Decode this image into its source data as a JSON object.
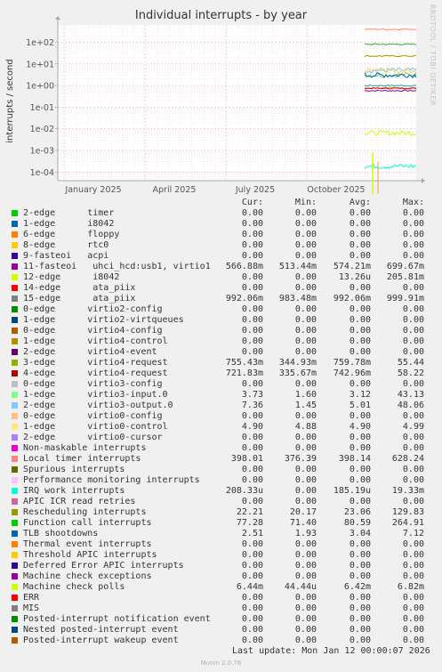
{
  "title": "Individual interrupts - by year",
  "side_label": "RRDTOOL / TOBI OETIKER",
  "chart_data": {
    "type": "line",
    "title": "Individual interrupts - by year",
    "ylabel": "interrupts / second",
    "yscale": "log",
    "y_ticks": [
      "1e+02",
      "1e+01",
      "1e+00",
      "1e-01",
      "1e-02",
      "1e-03",
      "1e-04"
    ],
    "x_ticks": [
      "January 2025",
      "April 2025",
      "July 2025",
      "October 2025"
    ],
    "grid": true,
    "series": [
      {
        "name": "11-fasteoi uhci_hcd:usb1, virtio1",
        "color": "#990099",
        "level": 0.574
      },
      {
        "name": "15-edge ata_piix",
        "color": "#339999",
        "level": 0.992
      },
      {
        "name": "3-edge virtio4-request",
        "color": "#99cc00",
        "level": 0.76
      },
      {
        "name": "4-edge virtio4-request",
        "color": "#cc0033",
        "level": 0.743
      },
      {
        "name": "1-edge virtio3-input.0",
        "color": "#66cc66",
        "level": 3.12
      },
      {
        "name": "2-edge virtio3-output.0",
        "color": "#66ccff",
        "level": 5.01
      },
      {
        "name": "1-edge virtio0-control",
        "color": "#ffcc66",
        "level": 4.9
      },
      {
        "name": "Local timer interrupts",
        "color": "#ff8866",
        "level": 398.14
      },
      {
        "name": "Rescheduling interrupts",
        "color": "#999900",
        "level": 23.06
      },
      {
        "name": "Function call interrupts",
        "color": "#33aa33",
        "level": 80.59
      },
      {
        "name": "TLB shootdowns",
        "color": "#0066b3",
        "level": 3.04
      },
      {
        "name": "Machine check polls",
        "color": "#ccff00",
        "level": 0.00642
      },
      {
        "name": "IRQ work interrupts",
        "color": "#00ffcc",
        "level": 0.000185
      }
    ]
  },
  "table": {
    "headers": {
      "cur": "Cur:",
      "min": "Min:",
      "avg": "Avg:",
      "max": "Max:"
    },
    "rows": [
      {
        "label": "2-edge      timer",
        "color": "#00cc00",
        "cur": "0.00",
        "min": "0.00",
        "avg": "0.00",
        "max": "0.00"
      },
      {
        "label": "1-edge      i8042",
        "color": "#0066b3",
        "cur": "0.00",
        "min": "0.00",
        "avg": "0.00",
        "max": "0.00"
      },
      {
        "label": "6-edge      floppy",
        "color": "#ff8000",
        "cur": "0.00",
        "min": "0.00",
        "avg": "0.00",
        "max": "0.00"
      },
      {
        "label": "8-edge      rtc0",
        "color": "#ffcc00",
        "cur": "0.00",
        "min": "0.00",
        "avg": "0.00",
        "max": "0.00"
      },
      {
        "label": "9-fasteoi   acpi",
        "color": "#330099",
        "cur": "0.00",
        "min": "0.00",
        "avg": "0.00",
        "max": "0.00"
      },
      {
        "label": "11-fasteoi   uhci_hcd:usb1, virtio1",
        "color": "#990099",
        "cur": "566.88m",
        "min": "513.44m",
        "avg": "574.21m",
        "max": "699.67m"
      },
      {
        "label": "12-edge      i8042",
        "color": "#ccff00",
        "cur": "0.00",
        "min": "0.00",
        "avg": "13.26u",
        "max": "205.81m"
      },
      {
        "label": "14-edge      ata_piix",
        "color": "#ff0000",
        "cur": "0.00",
        "min": "0.00",
        "avg": "0.00",
        "max": "0.00"
      },
      {
        "label": "15-edge      ata_piix",
        "color": "#808080",
        "cur": "992.06m",
        "min": "983.48m",
        "avg": "992.06m",
        "max": "999.91m"
      },
      {
        "label": "0-edge      virtio2-config",
        "color": "#008f00",
        "cur": "0.00",
        "min": "0.00",
        "avg": "0.00",
        "max": "0.00"
      },
      {
        "label": "1-edge      virtio2-virtqueues",
        "color": "#00487d",
        "cur": "0.00",
        "min": "0.00",
        "avg": "0.00",
        "max": "0.00"
      },
      {
        "label": "0-edge      virtio4-config",
        "color": "#b35a00",
        "cur": "0.00",
        "min": "0.00",
        "avg": "0.00",
        "max": "0.00"
      },
      {
        "label": "1-edge      virtio4-control",
        "color": "#b38f00",
        "cur": "0.00",
        "min": "0.00",
        "avg": "0.00",
        "max": "0.00"
      },
      {
        "label": "2-edge      virtio4-event",
        "color": "#6b006b",
        "cur": "0.00",
        "min": "0.00",
        "avg": "0.00",
        "max": "0.00"
      },
      {
        "label": "3-edge      virtio4-request",
        "color": "#8fb300",
        "cur": "755.43m",
        "min": "344.93m",
        "avg": "759.78m",
        "max": "55.44"
      },
      {
        "label": "4-edge      virtio4-request",
        "color": "#b30000",
        "cur": "721.83m",
        "min": "335.67m",
        "avg": "742.96m",
        "max": "58.22"
      },
      {
        "label": "0-edge      virtio3-config",
        "color": "#bebebe",
        "cur": "0.00",
        "min": "0.00",
        "avg": "0.00",
        "max": "0.00"
      },
      {
        "label": "1-edge      virtio3-input.0",
        "color": "#80ff80",
        "cur": "3.73",
        "min": "1.60",
        "avg": "3.12",
        "max": "43.13"
      },
      {
        "label": "2-edge      virtio3-output.0",
        "color": "#80c9ff",
        "cur": "7.36",
        "min": "1.45",
        "avg": "5.01",
        "max": "48.06"
      },
      {
        "label": "0-edge      virtio0-config",
        "color": "#ffc080",
        "cur": "0.00",
        "min": "0.00",
        "avg": "0.00",
        "max": "0.00"
      },
      {
        "label": "1-edge      virtio0-control",
        "color": "#ffe680",
        "cur": "4.90",
        "min": "4.88",
        "avg": "4.90",
        "max": "4.99"
      },
      {
        "label": "2-edge      virtio0-cursor",
        "color": "#aa80ff",
        "cur": "0.00",
        "min": "0.00",
        "avg": "0.00",
        "max": "0.00"
      },
      {
        "label": "Non-maskable interrupts",
        "color": "#ee00cc",
        "cur": "0.00",
        "min": "0.00",
        "avg": "0.00",
        "max": "0.00"
      },
      {
        "label": "Local timer interrupts",
        "color": "#ff8080",
        "cur": "398.01",
        "min": "376.39",
        "avg": "398.14",
        "max": "628.24"
      },
      {
        "label": "Spurious interrupts",
        "color": "#666600",
        "cur": "0.00",
        "min": "0.00",
        "avg": "0.00",
        "max": "0.00"
      },
      {
        "label": "Performance monitoring interrupts",
        "color": "#ffbfff",
        "cur": "0.00",
        "min": "0.00",
        "avg": "0.00",
        "max": "0.00"
      },
      {
        "label": "IRQ work interrupts",
        "color": "#00ffcc",
        "cur": "208.33u",
        "min": "0.00",
        "avg": "185.19u",
        "max": "19.33m"
      },
      {
        "label": "APIC ICR read retries",
        "color": "#cc6699",
        "cur": "0.00",
        "min": "0.00",
        "avg": "0.00",
        "max": "0.00"
      },
      {
        "label": "Rescheduling interrupts",
        "color": "#999900",
        "cur": "22.21",
        "min": "20.17",
        "avg": "23.06",
        "max": "129.83"
      },
      {
        "label": "Function call interrupts",
        "color": "#00cc00",
        "cur": "77.28",
        "min": "71.40",
        "avg": "80.59",
        "max": "264.91"
      },
      {
        "label": "TLB shootdowns",
        "color": "#0066b3",
        "cur": "2.51",
        "min": "1.93",
        "avg": "3.04",
        "max": "7.12"
      },
      {
        "label": "Thermal event interrupts",
        "color": "#ff8000",
        "cur": "0.00",
        "min": "0.00",
        "avg": "0.00",
        "max": "0.00"
      },
      {
        "label": "Threshold APIC interrupts",
        "color": "#ffcc00",
        "cur": "0.00",
        "min": "0.00",
        "avg": "0.00",
        "max": "0.00"
      },
      {
        "label": "Deferred Error APIC interrupts",
        "color": "#330099",
        "cur": "0.00",
        "min": "0.00",
        "avg": "0.00",
        "max": "0.00"
      },
      {
        "label": "Machine check exceptions",
        "color": "#990099",
        "cur": "0.00",
        "min": "0.00",
        "avg": "0.00",
        "max": "0.00"
      },
      {
        "label": "Machine check polls",
        "color": "#ccff00",
        "cur": "6.44m",
        "min": "44.44u",
        "avg": "6.42m",
        "max": "6.82m"
      },
      {
        "label": "ERR",
        "color": "#ff0000",
        "cur": "0.00",
        "min": "0.00",
        "avg": "0.00",
        "max": "0.00"
      },
      {
        "label": "MIS",
        "color": "#808080",
        "cur": "0.00",
        "min": "0.00",
        "avg": "0.00",
        "max": "0.00"
      },
      {
        "label": "Posted-interrupt notification event",
        "color": "#008f00",
        "cur": "0.00",
        "min": "0.00",
        "avg": "0.00",
        "max": "0.00"
      },
      {
        "label": "Nested posted-interrupt event",
        "color": "#00487d",
        "cur": "0.00",
        "min": "0.00",
        "avg": "0.00",
        "max": "0.00"
      },
      {
        "label": "Posted-interrupt wakeup event",
        "color": "#b35a00",
        "cur": "0.00",
        "min": "0.00",
        "avg": "0.00",
        "max": "0.00"
      }
    ]
  },
  "footer": "Last update: Mon Jan 12 00:00:07 2026",
  "munin_version": "Munin 2.0.76"
}
